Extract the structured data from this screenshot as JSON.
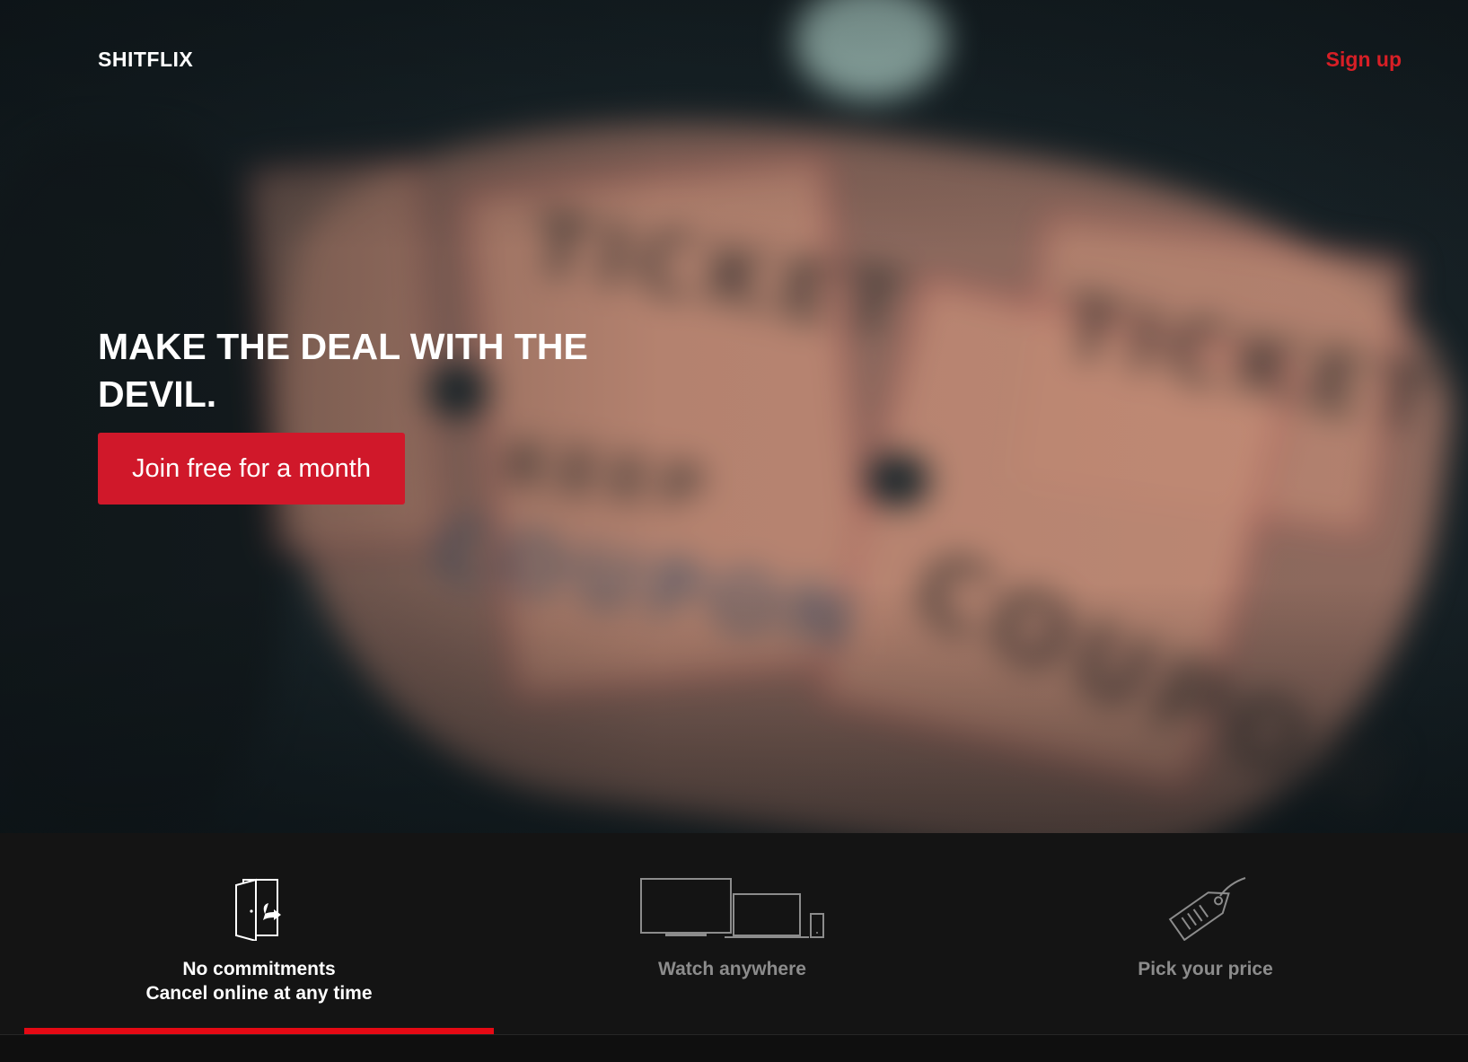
{
  "header": {
    "logo": "SHITFLIX",
    "signup_label": "Sign up"
  },
  "hero": {
    "headline": "MAKE THE DEAL WITH THE DEVIL.",
    "cta_label": "Join free for a month",
    "background_image": "blurred-movie-tickets"
  },
  "tabs": [
    {
      "icon": "door-exit-icon",
      "line1": "No commitments",
      "line2": "Cancel online at any time",
      "active": true
    },
    {
      "icon": "devices-icon",
      "line1": "Watch anywhere",
      "line2": "",
      "active": false
    },
    {
      "icon": "price-tag-icon",
      "line1": "Pick your price",
      "line2": "",
      "active": false
    }
  ],
  "colors": {
    "brand_red": "#e50914",
    "cta_red": "#d0182a",
    "background": "#141414",
    "inactive_text": "#8c8c8c"
  }
}
